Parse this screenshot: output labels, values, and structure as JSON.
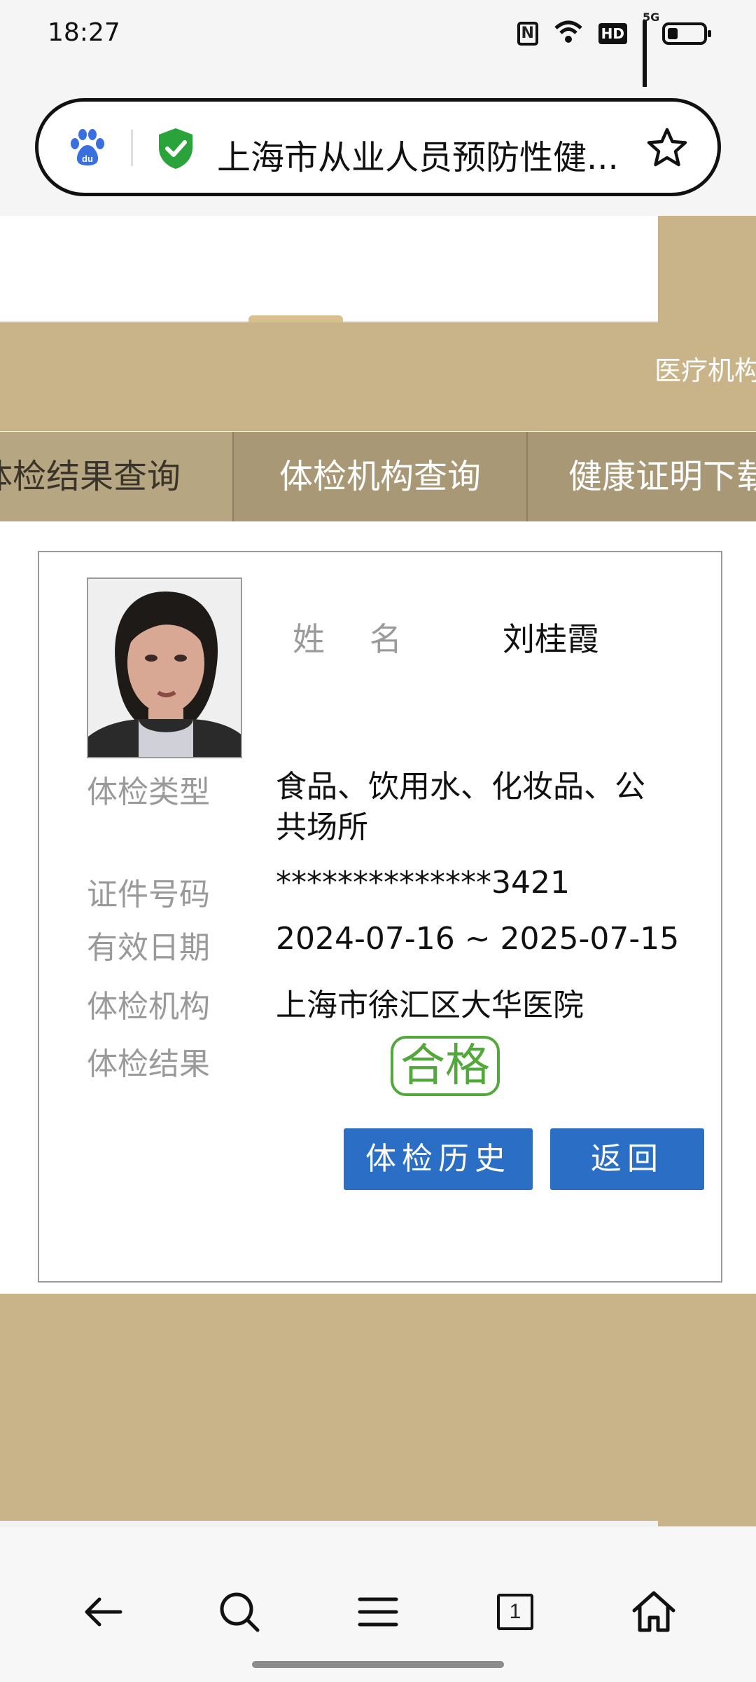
{
  "status_bar": {
    "time": "18:27",
    "icons": [
      "nfc-icon",
      "wifi-icon",
      "hd-icon",
      "5g-signal-icon",
      "battery-icon"
    ],
    "network": "5G",
    "hd": "HD",
    "nfc": "N"
  },
  "url_bar": {
    "title": "上海市从业人员预防性健..."
  },
  "site": {
    "header_link": "医疗机构",
    "nav_items": [
      "体检结果查询",
      "体检机构查询",
      "健康证明下载"
    ]
  },
  "record": {
    "name_label": "姓名",
    "name": "刘桂霞",
    "fields": [
      {
        "label": "体检类型",
        "value": "食品、饮用水、化妆品、公共场所"
      },
      {
        "label": "证件号码",
        "value": "**************3421"
      },
      {
        "label": "有效日期",
        "value": "2024-07-16 ~ 2025-07-15"
      },
      {
        "label": "体检机构",
        "value": "上海市徐汇区大华医院"
      },
      {
        "label": "体检结果",
        "value": ""
      }
    ],
    "result": "合格",
    "buttons": {
      "history": "体检历史",
      "back": "返回"
    }
  },
  "colors": {
    "gold": "#c9b48a",
    "nav": "#a99876",
    "button_blue": "#2a6fc5",
    "result_green": "#52a83a"
  },
  "bottom_nav": [
    "back-icon",
    "search-icon",
    "menu-icon",
    "tabs-icon",
    "home-icon"
  ],
  "bottom_nav_tabs_count": "1"
}
